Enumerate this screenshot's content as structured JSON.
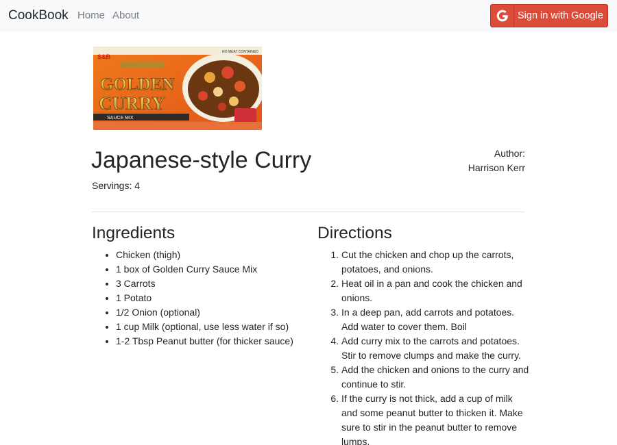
{
  "navbar": {
    "brand": "CookBook",
    "links": [
      "Home",
      "About"
    ],
    "google_button": {
      "label": "Sign in with Google",
      "color": "#dd4b39"
    }
  },
  "recipe": {
    "image_alt": "S&B Golden Curry Sauce Mix box",
    "image_text": {
      "brand": "S&B",
      "line1": "GOLDEN",
      "line2": "CURRY",
      "subtitle": "SAUCE MIX",
      "badge": "NO MEAT CONTAINED"
    },
    "title": "Japanese-style Curry",
    "servings": "Servings: 4",
    "author_label": "Author:",
    "author_name": "Harrison Kerr",
    "ingredients_heading": "Ingredients",
    "ingredients": [
      "Chicken (thigh)",
      "1 box of Golden Curry Sauce Mix",
      "3 Carrots",
      "1 Potato",
      "1/2 Onion (optional)",
      "1 cup Milk (optional, use less water if so)",
      "1-2 Tbsp Peanut butter (for thicker sauce)"
    ],
    "directions_heading": "Directions",
    "directions": [
      "Cut the chicken and chop up the carrots, potatoes, and onions.",
      "Heat oil in a pan and cook the chicken and onions.",
      "In a deep pan, add carrots and potatoes. Add water to cover them. Boil",
      "Add curry mix to the carrots and potatoes. Stir to remove clumps and make the curry.",
      "Add the chicken and onions to the curry and continue to stir.",
      "If the curry is not thick, add a cup of milk and some peanut butter to thicken it. Make sure to stir in the peanut butter to remove lumps."
    ]
  }
}
